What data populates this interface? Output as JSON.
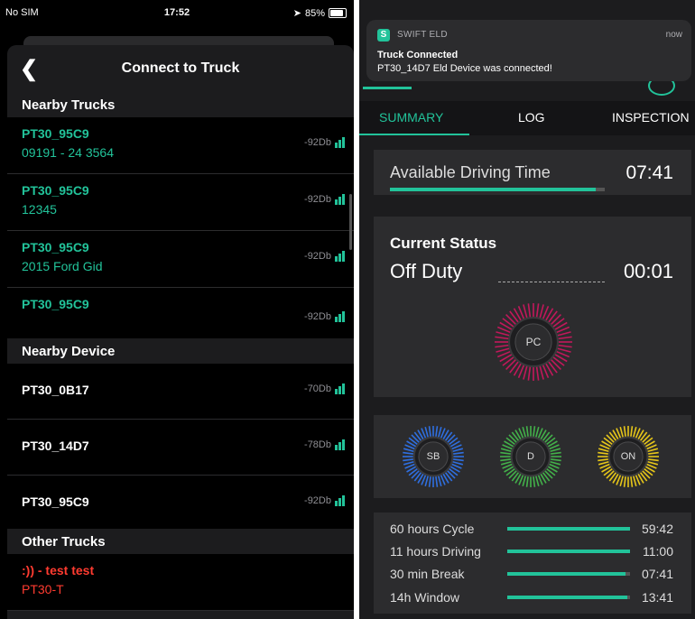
{
  "left": {
    "status_bar": {
      "carrier": "No SIM",
      "time": "17:52",
      "battery": "85%"
    },
    "nav": {
      "back_icon": "chevron-left",
      "title": "Connect to Truck"
    },
    "sections": {
      "nearby_trucks": "Nearby Trucks",
      "nearby_device": "Nearby Device",
      "other_trucks": "Other Trucks"
    },
    "nearby_trucks": [
      {
        "name": "PT30_95C9",
        "sub": "09191 - 24 3564",
        "signal": "-92Db"
      },
      {
        "name": "PT30_95C9",
        "sub": "12345",
        "signal": "-92Db"
      },
      {
        "name": "PT30_95C9",
        "sub": "2015 Ford Gid",
        "signal": "-92Db"
      },
      {
        "name": "PT30_95C9",
        "sub": "",
        "signal": "-92Db"
      }
    ],
    "nearby_devices": [
      {
        "name": "PT30_0B17",
        "signal": "-70Db"
      },
      {
        "name": "PT30_14D7",
        "signal": "-78Db"
      },
      {
        "name": "PT30_95C9",
        "signal": "-92Db"
      }
    ],
    "other_trucks": [
      {
        "name": ":)) - test test",
        "sub": "PT30-T"
      }
    ],
    "colors": {
      "accent": "#22c39a",
      "warning": "#ff3b30"
    }
  },
  "right": {
    "notification": {
      "app": "SWIFT ELD",
      "time": "now",
      "title": "Truck Connected",
      "body": "PT30_14D7 Eld Device was connected!"
    },
    "tabs": [
      "SUMMARY",
      "LOG",
      "INSPECTION"
    ],
    "active_tab": "SUMMARY",
    "available_driving": {
      "label": "Available Driving Time",
      "value": "07:41",
      "progress": 0.96
    },
    "current_status": {
      "heading": "Current Status",
      "status": "Off Duty",
      "time": "00:01"
    },
    "duty_buttons": {
      "pc": {
        "label": "PC",
        "color": "#c2185b"
      },
      "sb": {
        "label": "SB",
        "color": "#2f6fe0"
      },
      "d": {
        "label": "D",
        "color": "#43b04a"
      },
      "on": {
        "label": "ON",
        "color": "#e6c619"
      }
    },
    "cycles": [
      {
        "label": "60 hours Cycle",
        "value": "59:42",
        "progress": 1.0
      },
      {
        "label": "11 hours Driving",
        "value": "11:00",
        "progress": 1.0
      },
      {
        "label": "30 min Break",
        "value": "07:41",
        "progress": 0.96
      },
      {
        "label": "14h Window",
        "value": "13:41",
        "progress": 0.98
      }
    ]
  }
}
